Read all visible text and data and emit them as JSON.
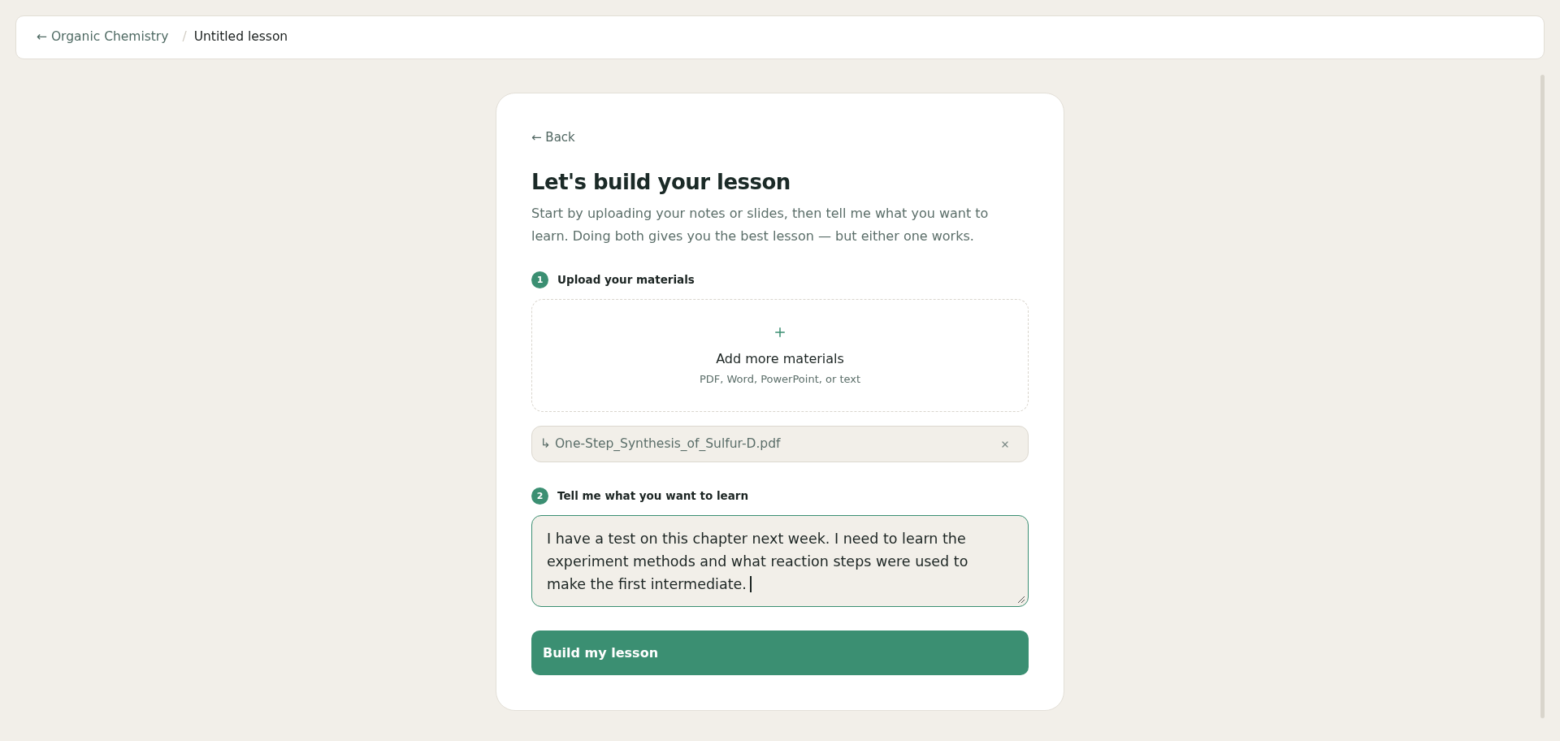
{
  "breadcrumb": {
    "parent": "← Organic Chemistry",
    "separator": "/",
    "current": "Untitled lesson"
  },
  "card": {
    "back_link": "← Back",
    "title": "Let's build your lesson",
    "subtitle": "Start by uploading your notes or slides, then tell me what you want to learn. Doing both gives you the best lesson — but either one works.",
    "upload_step": {
      "number": "1",
      "label": "Upload your materials",
      "dropzone": {
        "title": "Add more materials",
        "hint": "PDF, Word, PowerPoint, or text"
      },
      "files": [
        {
          "name": "↳ One-Step_Synthesis_of_Sulfur-D.pdf"
        }
      ]
    },
    "prompt_step": {
      "number": "2",
      "label": "Tell me what you want to learn",
      "field": {
        "value": "I have a test on this chapter next week. I need to learn the experiment methods and what reaction steps were used to make the first intermediate.",
        "focused": true
      }
    },
    "submit_button": {
      "label": "Build my lesson"
    }
  }
}
